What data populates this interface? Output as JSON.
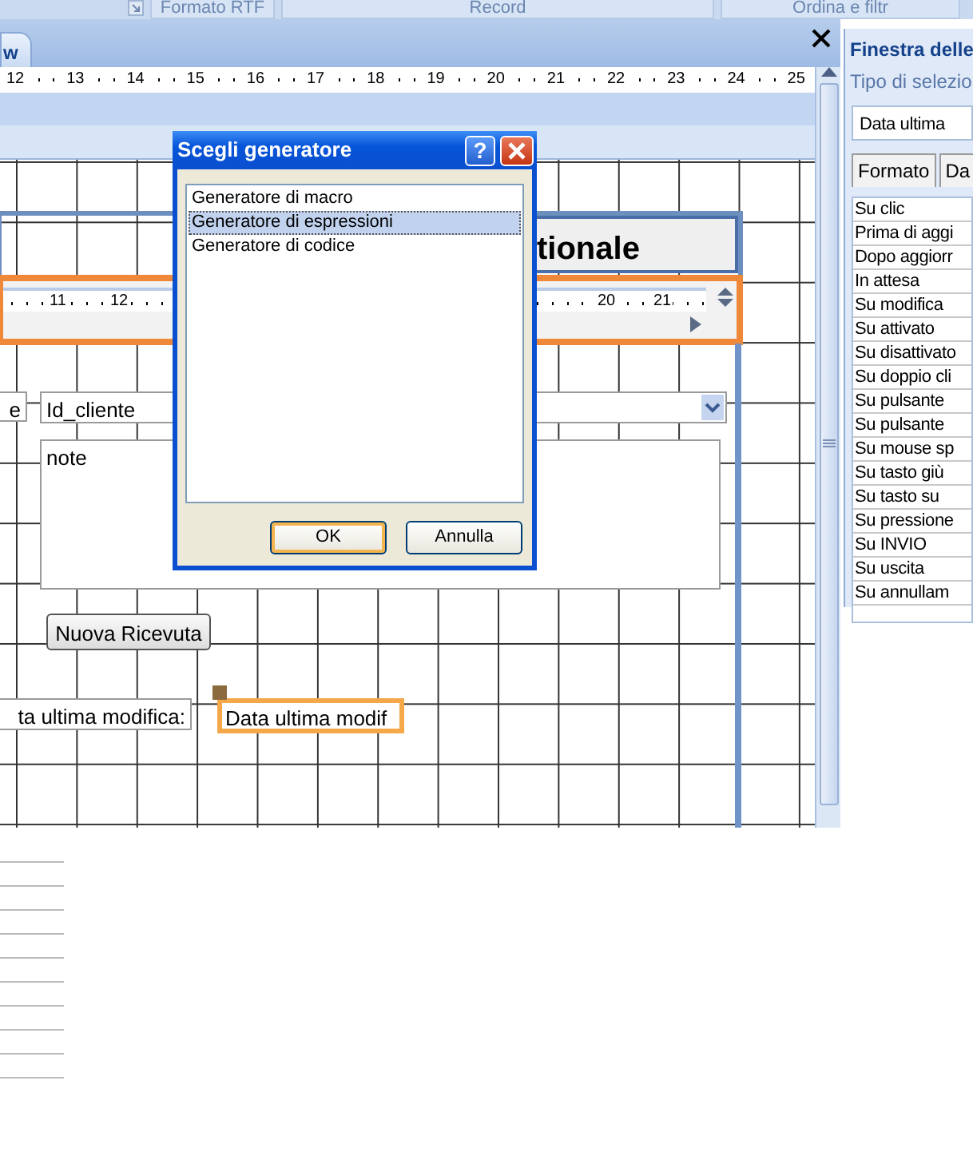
{
  "ribbon_groups": [
    {
      "label": "Formato RTF"
    },
    {
      "label": "Record"
    },
    {
      "label": "Ordina e filtr"
    }
  ],
  "document_tab": {
    "label": "w",
    "selected": true
  },
  "ruler": [
    "12",
    "13",
    "14",
    "15",
    "16",
    "17",
    "18",
    "19",
    "20",
    "21",
    "22",
    "23",
    "24",
    "25"
  ],
  "subform": {
    "header_label": "tionale",
    "ruler": [
      "11",
      "12",
      "20",
      "21"
    ]
  },
  "controls": [
    {
      "kind": "label",
      "text": "e",
      "selected": false
    },
    {
      "kind": "combo",
      "text": "Id_cliente",
      "selected": false
    },
    {
      "kind": "textbox",
      "text": "note",
      "selected": false
    },
    {
      "kind": "button",
      "text": "Nuova Ricevuta",
      "selected": false
    },
    {
      "kind": "label",
      "text": "ta ultima modifica:",
      "selected": false
    },
    {
      "kind": "textbox",
      "text": "Data ultima modif",
      "selected": true
    }
  ],
  "property_sheet": {
    "title": "Finestra delle",
    "selection_type": "Tipo di selezio",
    "object": "Data ultima",
    "tabs": [
      {
        "label": "Formato"
      },
      {
        "label": "Da"
      }
    ],
    "rows": [
      "Su clic",
      "Prima di aggi",
      "Dopo aggiorr",
      "In attesa",
      "Su modifica",
      "Su attivato",
      "Su disattivato",
      "Su doppio cli",
      "Su pulsante",
      "Su pulsante",
      "Su mouse sp",
      "Su tasto giù",
      "Su tasto su",
      "Su pressione",
      "Su INVIO",
      "Su uscita",
      "Su annullam"
    ]
  },
  "dialog": {
    "title": "Scegli generatore",
    "help": "?",
    "items": [
      {
        "label": "Generatore di macro",
        "selected": false
      },
      {
        "label": "Generatore di espressioni",
        "selected": true
      },
      {
        "label": "Generatore di codice",
        "selected": false
      }
    ],
    "buttons": [
      {
        "label": "OK",
        "default": true
      },
      {
        "label": "Annulla",
        "default": false
      }
    ]
  }
}
